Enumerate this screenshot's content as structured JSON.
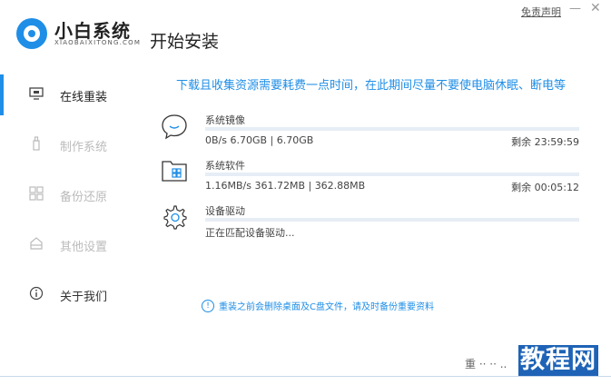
{
  "header": {
    "brand_cn": "小白系统",
    "brand_en": "XIAOBAIXITONG.COM",
    "page_title": "开始安装",
    "disclaimer": "免责声明",
    "minimize": "—",
    "close": "✕"
  },
  "sidebar": {
    "items": [
      {
        "label": "在线重装",
        "icon": "monitor-icon",
        "active": true
      },
      {
        "label": "制作系统",
        "icon": "usb-icon",
        "active": false
      },
      {
        "label": "备份还原",
        "icon": "backup-icon",
        "active": false
      },
      {
        "label": "其他设置",
        "icon": "settings-box-icon",
        "active": false
      },
      {
        "label": "关于我们",
        "icon": "info-icon",
        "active": false
      }
    ]
  },
  "main": {
    "notice": "下载且收集资源需要耗费一点时间，在此期间尽量不要使电脑休眠、断电等",
    "tasks": [
      {
        "name": "系统镜像",
        "icon": "chat-bubble-icon",
        "stats": "0B/s 6.70GB | 6.70GB",
        "remaining": "剩余 23:59:59",
        "progress": 0
      },
      {
        "name": "系统软件",
        "icon": "folder-icon",
        "stats": "1.16MB/s 361.72MB | 362.88MB",
        "remaining": "剩余 00:05:12",
        "progress": 0
      },
      {
        "name": "设备驱动",
        "icon": "gear-icon",
        "stats": "正在匹配设备驱动...",
        "remaining": "",
        "progress": 0
      }
    ],
    "warning": "重装之前会删除桌面及C盘文件，请及时备份重要资料"
  },
  "footer": {
    "watermark_small": "重 ·· ·· ..",
    "watermark": "教程网"
  },
  "colors": {
    "accent": "#1f8ee6",
    "bar_track": "#e6edf5",
    "watermark_bg": "#1e63b6"
  }
}
